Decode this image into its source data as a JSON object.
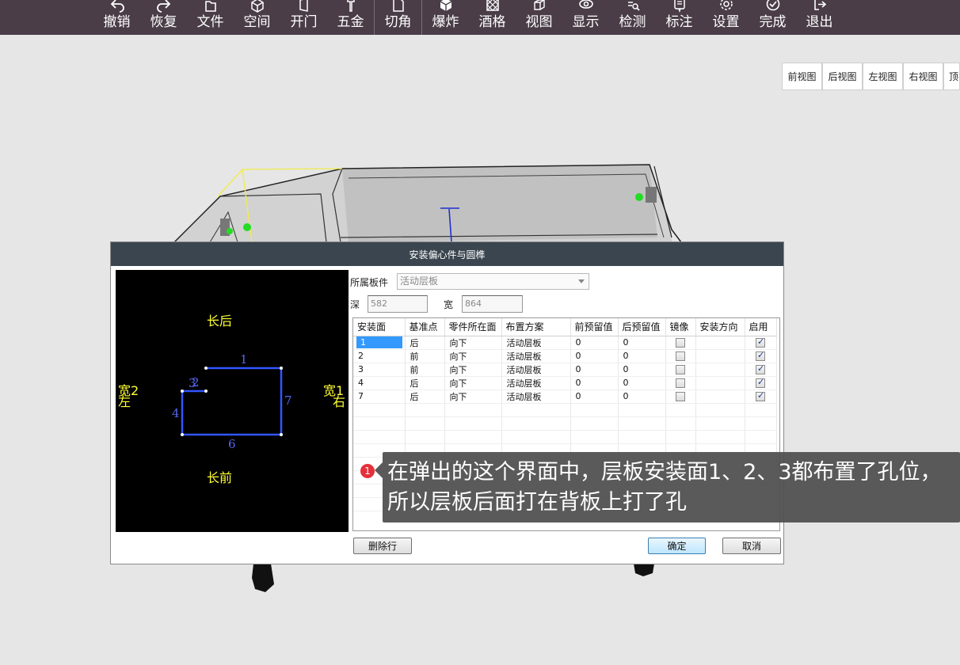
{
  "toolbar": {
    "items": [
      {
        "label": "撤销",
        "icon": "undo-icon"
      },
      {
        "label": "恢复",
        "icon": "redo-icon"
      },
      {
        "label": "文件",
        "icon": "file-icon"
      },
      {
        "label": "空间",
        "icon": "cube-icon"
      },
      {
        "label": "开门",
        "icon": "door-icon"
      },
      {
        "label": "五金",
        "icon": "hardware-icon"
      },
      {
        "label": "切角",
        "icon": "cut-corner-icon"
      },
      {
        "label": "爆炸",
        "icon": "explode-icon"
      },
      {
        "label": "酒格",
        "icon": "wine-grid-icon"
      },
      {
        "label": "视图",
        "icon": "view-icon"
      },
      {
        "label": "显示",
        "icon": "eye-icon"
      },
      {
        "label": "检测",
        "icon": "inspect-icon"
      },
      {
        "label": "标注",
        "icon": "annotate-icon"
      },
      {
        "label": "设置",
        "icon": "gear-icon"
      },
      {
        "label": "完成",
        "icon": "check-icon"
      },
      {
        "label": "退出",
        "icon": "exit-icon"
      }
    ]
  },
  "views": [
    "前视图",
    "后视图",
    "左视图",
    "右视图",
    "顶视"
  ],
  "dialog": {
    "title": "安装偏心件与圆榫",
    "board_label": "所属板件",
    "board_value": "活动层板",
    "depth_label": "深",
    "depth_value": "582",
    "width_label": "宽",
    "width_value": "864",
    "preview": {
      "top": "长后",
      "bottom": "长前",
      "left_top": "宽2",
      "left_bottom": "左",
      "right_top": "宽1",
      "right_bottom": "右",
      "edge_1": "1",
      "edge_2": "2",
      "edge_3": "3",
      "edge_4": "4",
      "edge_6": "6",
      "edge_7": "7"
    },
    "columns": [
      "安装面",
      "基准点",
      "零件所在面",
      "布置方案",
      "前预留值",
      "后预留值",
      "镜像",
      "安装方向",
      "启用"
    ],
    "rows": [
      {
        "face": "1",
        "ref": "后",
        "side": "向下",
        "plan": "活动层板",
        "front": "0",
        "back": "0",
        "mirror": false,
        "dir": "",
        "enabled": true
      },
      {
        "face": "2",
        "ref": "前",
        "side": "向下",
        "plan": "活动层板",
        "front": "0",
        "back": "0",
        "mirror": false,
        "dir": "",
        "enabled": true
      },
      {
        "face": "3",
        "ref": "前",
        "side": "向下",
        "plan": "活动层板",
        "front": "0",
        "back": "0",
        "mirror": false,
        "dir": "",
        "enabled": true
      },
      {
        "face": "4",
        "ref": "后",
        "side": "向下",
        "plan": "活动层板",
        "front": "0",
        "back": "0",
        "mirror": false,
        "dir": "",
        "enabled": true
      },
      {
        "face": "7",
        "ref": "后",
        "side": "向下",
        "plan": "活动层板",
        "front": "0",
        "back": "0",
        "mirror": false,
        "dir": "",
        "enabled": true
      }
    ],
    "delete_button": "删除行",
    "ok_button": "确定",
    "cancel_button": "取消"
  },
  "callout": {
    "badge": "1",
    "text": "在弹出的这个界面中，层板安装面1、2、3都布置了孔位，所以层板后面打在背板上打了孔"
  },
  "colors": {
    "toolbar_bg": "#4a3d48",
    "dialog_title_bg": "#3a454f",
    "preview_label": "#ffff33",
    "preview_outline": "#3355ff"
  }
}
